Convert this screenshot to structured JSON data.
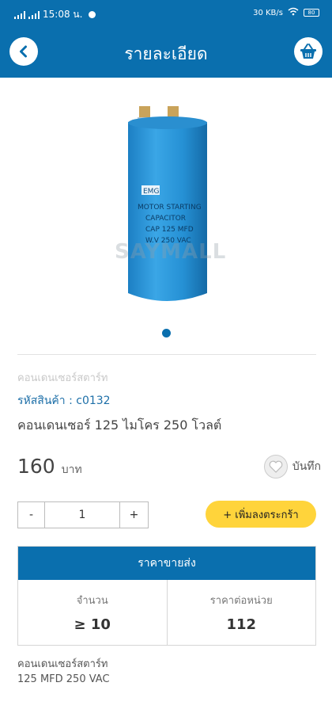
{
  "status_bar": {
    "time": "15:08 น.",
    "right_info": "30 KB/s",
    "battery": "80"
  },
  "header": {
    "title": "รายละเอียด"
  },
  "gallery": {
    "watermark": "SAYMALL"
  },
  "product": {
    "breadcrumb": "คอนเดนเซอร์สตาร์ท",
    "sku": "รหัสสินค้า : c0132",
    "name": "คอนเดนเซอร์ 125 ไมโคร 250 โวลต์",
    "price": "160",
    "currency": "บาท",
    "save_label": "บันทึก"
  },
  "qty": {
    "minus": "-",
    "value": "1",
    "plus": "+"
  },
  "add_to_cart": "+ เพิ่มลงตระกร้า",
  "wholesale": {
    "title": "ราคาขายส่ง",
    "qty_label": "จำนวน",
    "qty_value": "≥ 10",
    "unit_price_label": "ราคาต่อหน่วย",
    "unit_price_value": "112"
  },
  "description": {
    "line1": "คอนเดนเซอร์สตาร์ท",
    "line2": "125 MFD 250 VAC"
  },
  "capacitor_label": {
    "brand": "EMG",
    "line1": "MOTOR STARTING",
    "line2": "CAPACITOR",
    "line3": "CAP 125 MFD",
    "line4": "W.V 250 VAC"
  },
  "colors": {
    "primary": "#0a6fae",
    "accent": "#ffd43b"
  }
}
